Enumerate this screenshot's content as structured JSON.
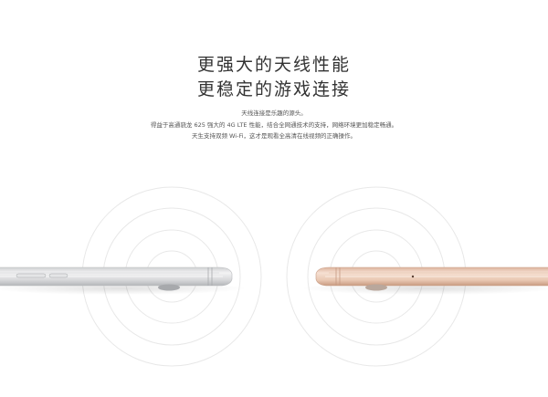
{
  "headline": {
    "line1": "更强大的天线性能",
    "line2": "更稳定的游戏连接"
  },
  "description": [
    "天线连接是乐趣的源头。",
    "得益于高通骁龙 625 强大的 4G LTE 性能，结合全网通技术的支持，网络环境更加稳定畅通。",
    "天生支持双频 Wi-Fi，这才是观看全高清在线视频的正确操作。"
  ],
  "colors": {
    "silver": "#d9dadb",
    "rose_gold": "#e7c6b1",
    "ring": "#e6e6e6"
  },
  "icons": [
    "signal-rings-left",
    "signal-rings-right"
  ]
}
